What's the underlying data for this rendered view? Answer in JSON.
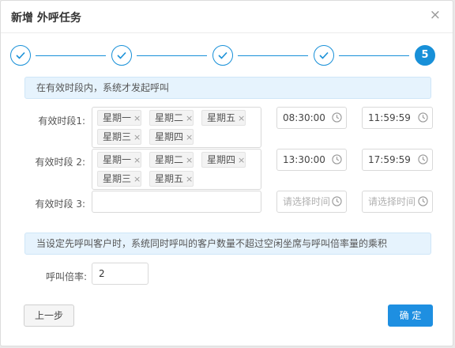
{
  "dialog": {
    "title": "新增 外呼任务",
    "close": "×"
  },
  "steps": {
    "current": "5"
  },
  "info1": "在有效时段内，系统才发起呼叫",
  "periods": [
    {
      "label": "有效时段1:",
      "tags": [
        [
          "星期一",
          "星期二",
          "星期五"
        ],
        [
          "星期三",
          "星期四"
        ]
      ],
      "start": "08:30:00",
      "end": "11:59:59"
    },
    {
      "label": "有效时段 2:",
      "tags": [
        [
          "星期一",
          "星期二",
          "星期四"
        ],
        [
          "星期三",
          "星期五"
        ]
      ],
      "start": "13:30:00",
      "end": "17:59:59"
    },
    {
      "label": "有效时段 3:",
      "tags": [],
      "start_placeholder": "请选择时间",
      "end_placeholder": "请选择时间"
    }
  ],
  "tag_remove": "×",
  "info2": "当设定先呼叫客户时，系统同时呼叫的客户数量不超过空闲坐席与呼叫倍率量的乘积",
  "ratio": {
    "label": "呼叫倍率:",
    "value": "2"
  },
  "buttons": {
    "prev": "上一步",
    "ok": "确 定"
  },
  "colors": {
    "primary": "#1e8fe1",
    "info_bg": "#e6f3fd"
  }
}
